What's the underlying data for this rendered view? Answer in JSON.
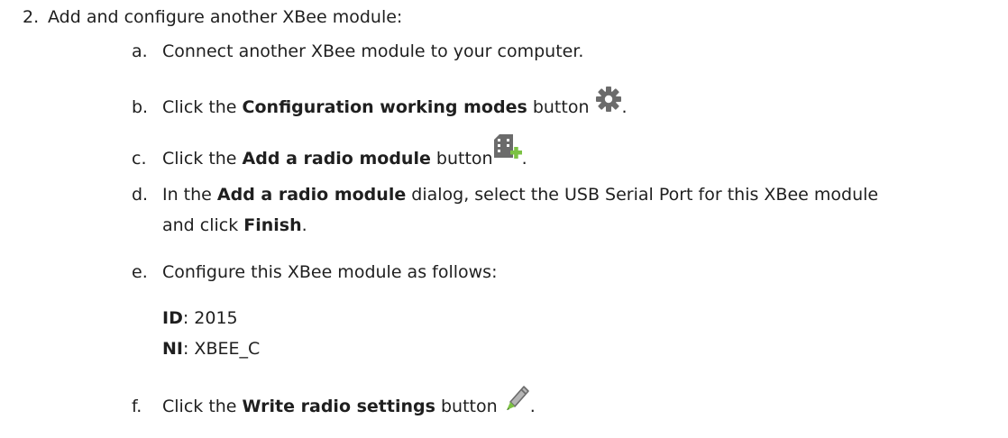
{
  "step": {
    "number": "2.",
    "text": "Add and configure another XBee module:"
  },
  "substeps": {
    "a": {
      "letter": "a.",
      "text": "Connect another XBee module to your computer."
    },
    "b": {
      "letter": "b.",
      "pre": "Click the ",
      "bold": "Configuration working modes",
      "post": " button",
      "end": ".",
      "icon": "gear-icon"
    },
    "c": {
      "letter": "c.",
      "pre": "Click the ",
      "bold": "Add a radio module",
      "post": " button",
      "end": ".",
      "icon": "add-radio-module-icon"
    },
    "d": {
      "letter": "d.",
      "pre": "In the ",
      "bold": "Add a radio module",
      "post": " dialog, select the USB Serial Port for this XBee module",
      "line2_pre": "and click ",
      "line2_bold": "Finish",
      "line2_end": "."
    },
    "e": {
      "letter": "e.",
      "text": "Configure this XBee module as follows:"
    },
    "f": {
      "letter": "f.",
      "pre": "Click the ",
      "bold": "Write radio settings",
      "post": " button",
      "end": ".",
      "icon": "pencil-icon"
    }
  },
  "settings": {
    "id_label": "ID",
    "id_value": ": 2015",
    "ni_label": "NI",
    "ni_value": ": XBEE_C"
  },
  "colors": {
    "text": "#1f1f1f",
    "icon_gray": "#6b6b6b",
    "icon_green": "#7cc243"
  }
}
